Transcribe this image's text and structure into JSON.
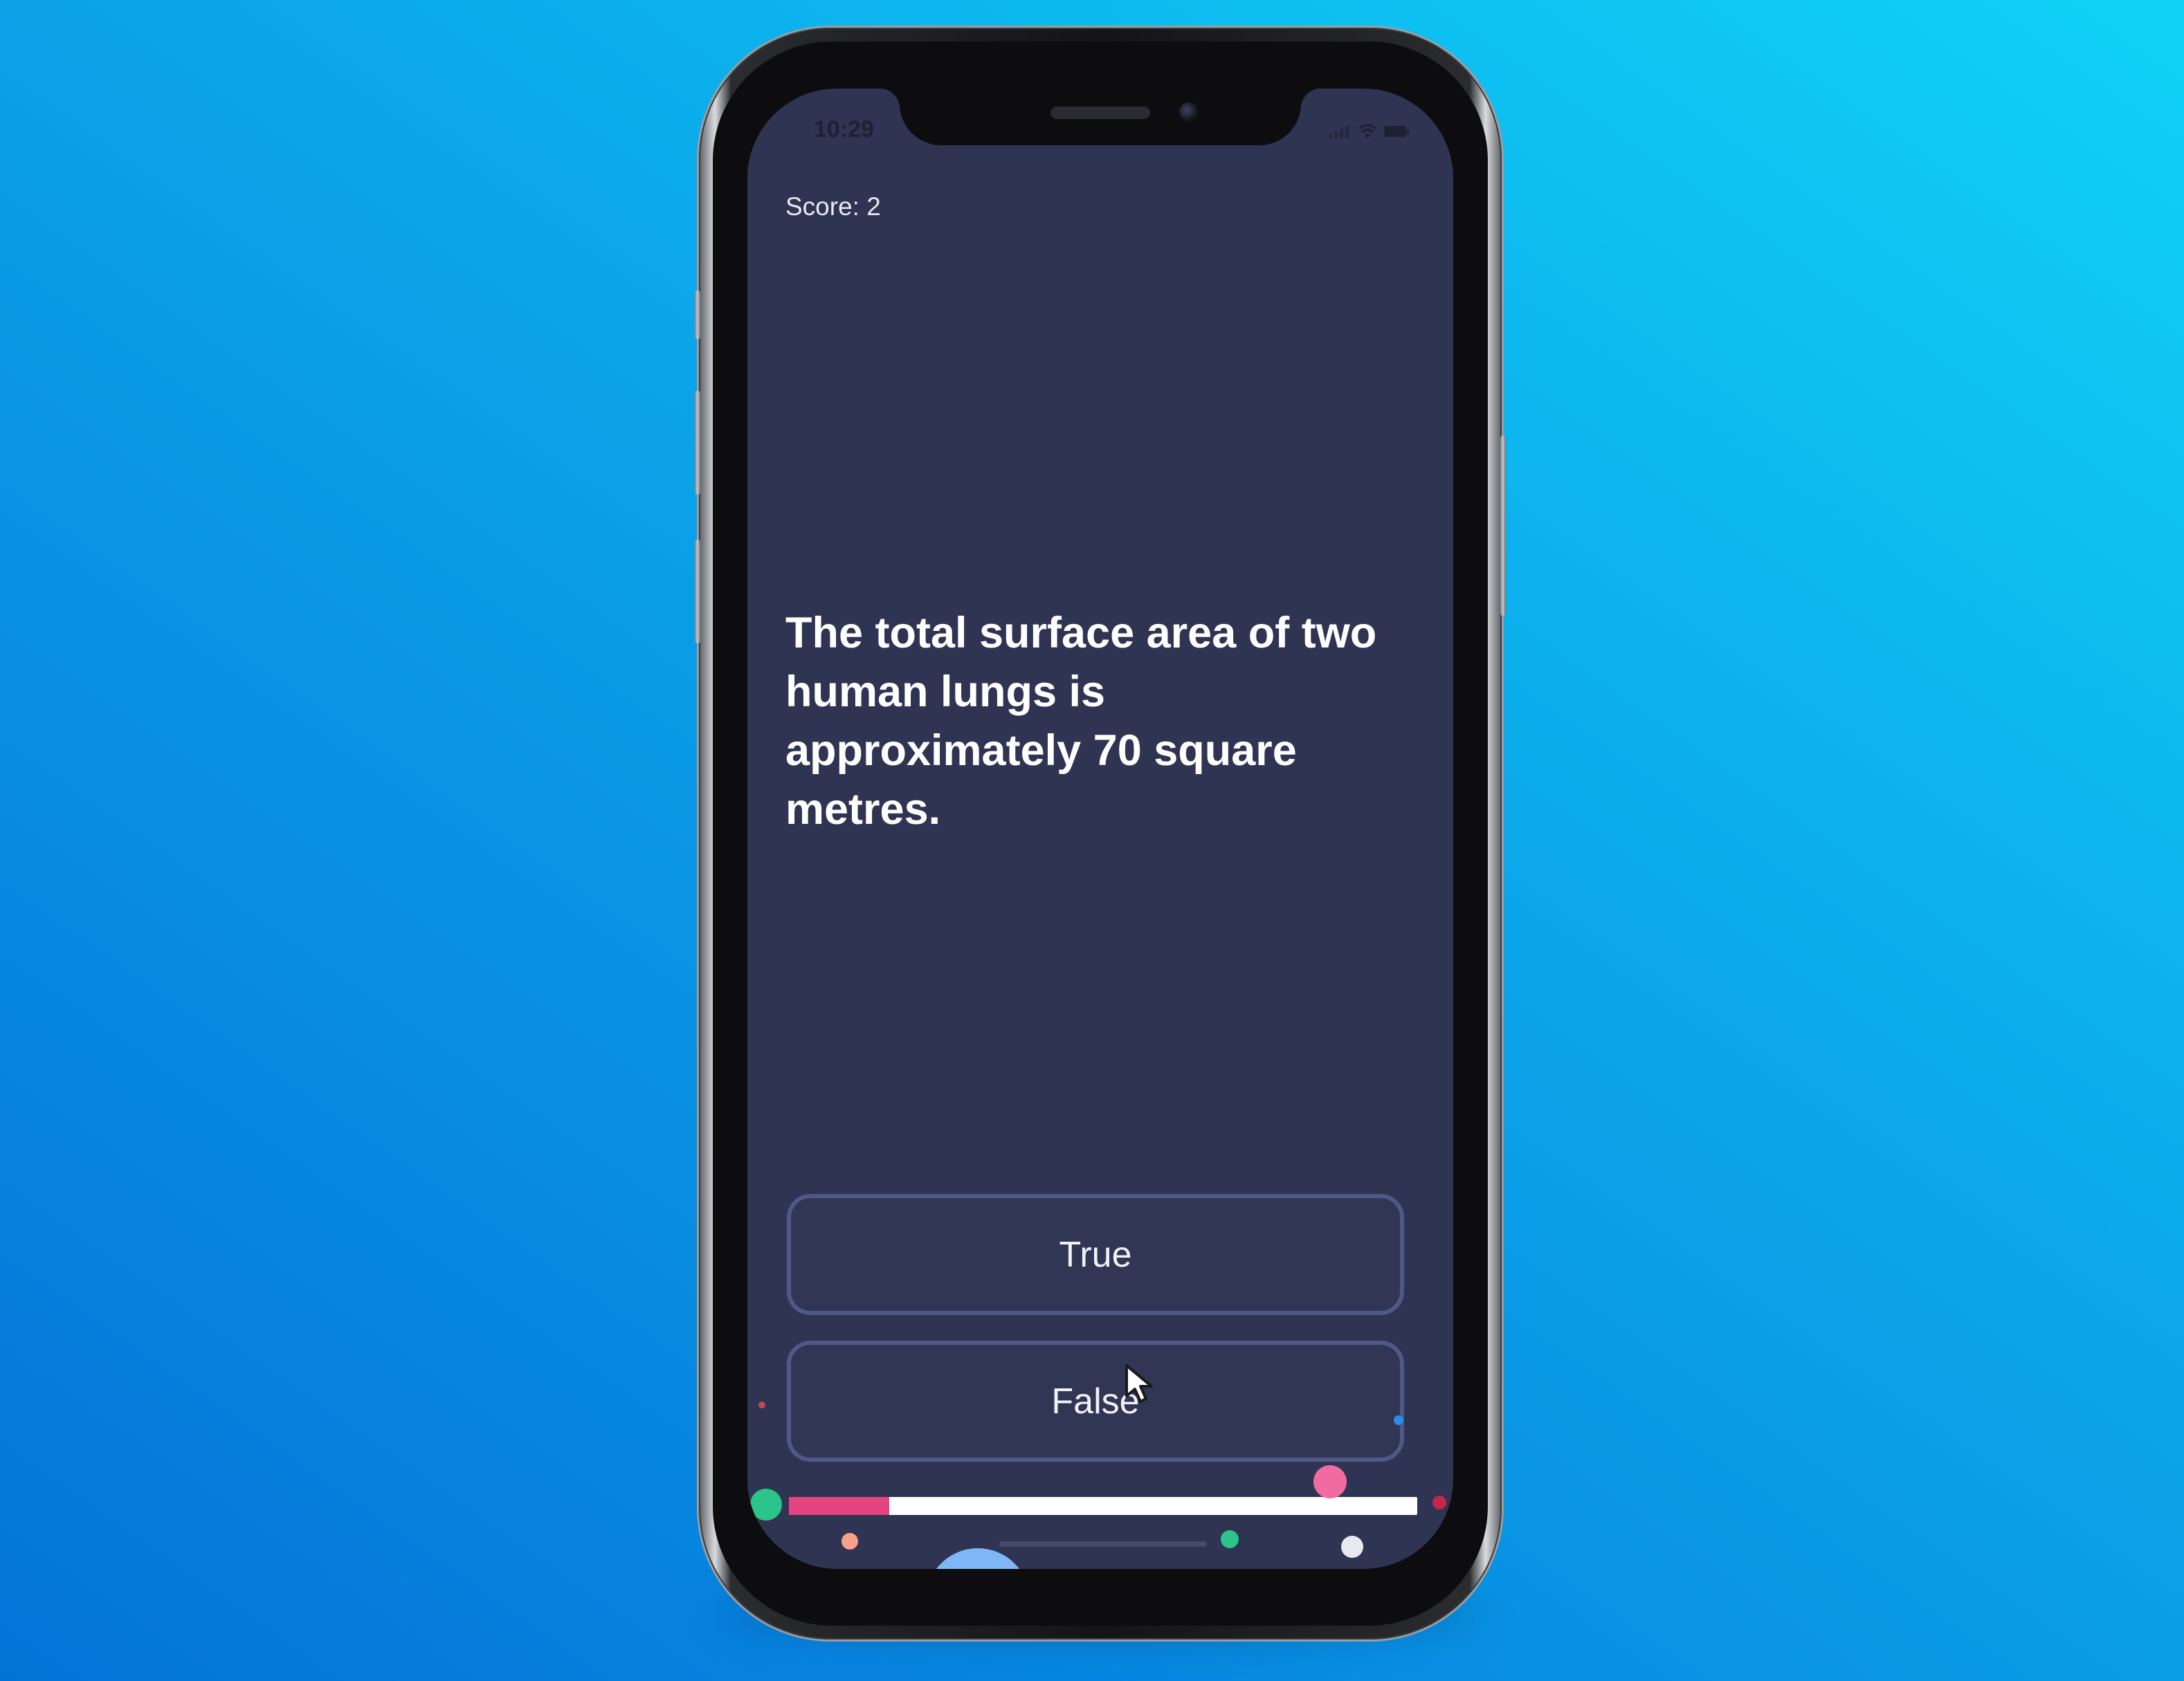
{
  "status_bar": {
    "time": "10:29",
    "icons": [
      "signal-icon",
      "wifi-icon",
      "battery-icon"
    ]
  },
  "quiz": {
    "score_label": "Score: 2",
    "question": "The total surface area of two human lungs is approximately 70 square metres.",
    "answers": {
      "true_label": "True",
      "false_label": "False"
    },
    "progress": 0.16
  },
  "colors": {
    "background_start": "#0473d9",
    "background_end": "#10d2f6",
    "screen_bg": "#2f3453",
    "button_border": "#4e5987",
    "progress_fill": "#e3447f",
    "progress_track": "#ffffff",
    "confetti": [
      "#2bc48a",
      "#f06b9f",
      "#f6a08a",
      "#e8e9f0",
      "#7fb6f5"
    ]
  }
}
